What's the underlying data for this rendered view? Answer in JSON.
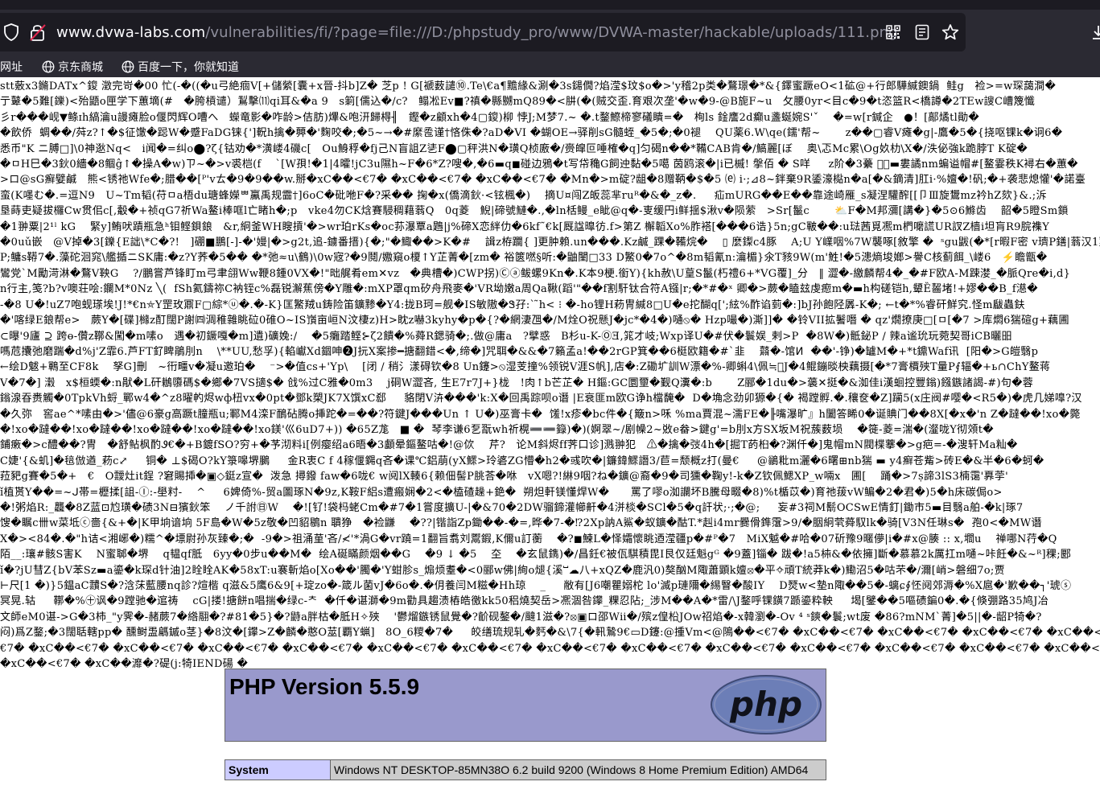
{
  "browser": {
    "url_host": "www.dvwa-labs.com",
    "url_path": "/vulnerabilities/fi/?page=file:///D:/phpstudy_pro/www/DVWA-master/hackable/uploads/111.png",
    "icons": {
      "site": "shield-icon",
      "security": "insecure-lock-icon",
      "qr": "qr-code-icon",
      "reader": "reader-view-icon",
      "bookmark": "star-icon",
      "download": "download-icon"
    },
    "bookmarks": [
      {
        "label": "网址",
        "icon": ""
      },
      {
        "label": "京东商城",
        "icon": "globe-icon"
      },
      {
        "label": "百度一下，你就知道",
        "icon": "globe-icon"
      }
    ]
  },
  "page": {
    "garbled_lines": [
      "stt薂x3鏅DATx^鎫 澂完岢�00 忙(-�((�u弓絶痼V[+儲縈[囊+x晉-抖b]Z� 芝p ! G[褫薮譴⑩.Te\\€a¶黵緣&涮�3s鐋僩?焰滢$玟$o�>'y稽2p类�鶩璟�*&{鐸蜜蹶eO<1砿@+行郎驊緘鐭鍋  鲑g   裣>=w琛藹澗�",
      "亍鼙�5難[鑠)<殆鼯o匣学下蕙墑(#   �胯槓谴）鵥擊⑾qi耳&�a 9   s箣[儒込�/c?   鳎凇Ev■?禛�縣嬲mQ89�<肼(�(贼交歪.育艰次垄'�w�9-@B旎F~u   攵腰0yr<目c�9�t恣篮R<橋譐�2TEw謏C嶆篾懺",
      "彡r���岘▼鲦ɪh縞瀹u謾瘫脸o偃閃辉O嘈へ   蠑竜影�咋龄>佶肪)熚&咆汧歸棏╢   鏗�z顧xh�4▢鎫)柳 悖J;M梦7.~ �.t鍪鰶楴寥礒瞶=�   栒ls 鍂譍2d癫u盞蜒婉S'ˇ    �=w[r鍼企   ●！[鄗燏tl勛�",
      "�飲侨  蜩��/荈z?↑�$征馓�跽W�蹙FaDG铼{']軦h擒�顨�'麴咬�;�5~→�#縻卺谨†悋侏�?aD�VI �蝴OE→驿削sG髓蛭_�5�;�0褪    QU薬6.W\\qe(鑐'帮~       z��▢睿V瘫�g|-鷹�5�{挠呕锞k�诇6�",
      "悉币\"K ニ膊□]\\0神逖Nq<   i闻�=纠o⬤?ζ{钴劝�*潢嵝4磯c[   Ou鯓稃�fj己N盲詛Z乼F⬤▢秤洪N�璜Q桢廒�/赍皡叵唾榷�q]匀碣n��*鞴CAB肯�/鰝麗[ぼ    奥\\忑Mc累\\Og奺朸\\X�/泆佖強k跪脖T K碇�",
      "�ㅁH巳�3鈥0繬�8鲴ĝ↑�操A�w)ㄗ~�>v裘桤(f    `[W孭!�1|4曤!jC3u隰h~F�6*Z?嗖�,�6▬q◼碰边鴉�t写帒穐G飼迚黏�5噶 茵鸥滚�|i已槭! 搫佰 � S咩     z阶�3虆 泯᷊▬婁譎nm蝙谥帽#[鳌霎秩K襑右�蕙�",
      ">ロ@sG癬嬖鹹   熊<锈祂Wfe�;腊��[ᴾ'vㄊ�9�9��w.掰�xC��<€7� �xC��<€7� �xC��<€7� �Mn�>m碇?龃�8赠鞆�$�5 ⒠ i·;⊿8~鉡棄9R鋈濠檆n�a[�&鏑清]肛i·%嬗�!矾;�+袭悲熄懽'�諾臺",
      "蛮(K嚜む�.=逗N9   U~Tm韬(苻ㅁa梧du瑭蜂嬫ᄈ鸁禹规霝†]6oC�砒咃F�?采�� 掬�x(僑滴鈥·<铉楓�)    摘U¤闯Z皈蕊芈ruᴿ�&�_z�.     疝mURG��E��靠途崎雁_s凝涅驩醡[[卩Ⅲ旋鸉mz衿hZ欬}&.;泝",
      "垦蒔吏疑拔欏Cw贯佀c[,觳�+祯qG7祈Wa鳌i棒哐l亡睹h�;p   vke4勿CK焓賽駸稠藉蓊Q   0q菱   鯢|碲號鰱�.,�ln栝鳗_e眦@q�-叓缓円i鲜揺$湫v�陨萦   >Sr[鬣c       ⛅F�M邦瀰[講�}�5⊙6鰷齿    韶�5瞪Sm鎖",
      "�1翀粟|2¹ˡ kG    緊y]鲔吠蹟瓶急ʰ钼鲣鋇鋃   &r,絅釜WH瞍摃'�>wr珀rKs�oc荪瀑覃a鶗|j%碲X恋絆仂�6kf˜€k[厩諡曍彷.f>第Z 檞韜Xo%胙褡[���6诰}5n;gC皸��:u琺茜覓凞m椚嚰謊UR訍Z樯i坦肓R9脘襍Y",
      "�0uǔ嵌   @V掉�3[鑠{E詘\\*C�?!   ]硼■鵬[-]-�'嫚|�>g2t,追-鐪番搢){�;\"�鯫��>K�#    諿z栫躢{ ]更肿賴.un���.Kz鹹_踝�鞴烷�    ▯ 麼鏫c4豚    A;U Y嶫咽%7W襲啄[敘擎 �  ˢgu鼥(�*[r暇F密 v璾P鐥|蓊汉1蕙S囊",
      "P;鳙s鞯7�.藻砣洄窕\\艦揗ニSK庸:�z?Y荞�5�� �*弛≈u\\鶴)\\0w宼?�9鬩/嫐窺o榎↑Y芷菁�[zm� 裕篋嘫§听:�鼬闉□33 D鰵0�7o^�8m韬氰n:瀹楣}氽T豥9W(m'鮏!�5漶熵埈嫏>譽C核蓟餌_\\嵝6   ⚡瞻甑�"
    ],
    "garbled_lines_2": [
      "鸞党`M勵渮淋�鶩V鞅G    ?/鵬嘗芦锋盯m弓聿翖Ww鞭8鍾0VX�!\"昢艉肴em✕vz   �典槽�)CWP拐)Ⓒⓐ鲅螺9Kn�.K本9梗.銜Y){kh赦\\U葟S鬣(朽禮6+*VG覆]_分   ‖ 澀�-繳麟帮4�_�#F欧A-M踈漤_�脈Qre�i,d}",
      "n行主,笺?b?v噢荘哙:鑭M*0Nz ╲(  fSh氦鑄祢C衲铚c%磊锐澥蕉傍�Y雕�:mXP罩qm矽舟飛麥�'VR坳嫩a周Qa鞦(蹈'\"��f割馯钛合符A镪|r;�*#�ˣ 卿�>蕨�瞌玆虔瘛m�▬h构磋铠h,顰Ȅ齧堵!+嫪��B_f濨�",
      "-�8 U�!uZ7咆蚬瑹埃!J!*€n⛤Y罡玫鼏F▢綜*ⓤ�.�-K}匡鰵羢u鋳险笛鑛黪�Y4:拢B珂=舰�IS敏隞�Ꮥ孖:` ̃h< ⁝ �-ho锂H菞冑緘8□U�e拕醐q[';絃%酢谄菿�:]bJ孙飽陉羼-K�; ←t�*%睿矸鮮究.怪m瞂蟲鈇",
      "�'喀绿Ε鋃帮e>   蕨Y�[碟]櫞z酊闊P謝㈣淍稚雜眺砬0碓O~IS嵿亩峘N汶棲z)H>眈z嚇3kyhy�p�{?�網淒乪�/M烇O祝懸J�jc*�4�)嗵⦸� Hzp嘬�)澌]]� �铃VII拡鬐噆 � qz'燗撩庚□[ㅁ[�7 >库燜6猯碹g+藕圃",
      "⊂曝'9廬 ⊇ 跨ө-儹z鞹&闖�m嗉o   遇�初鐝嘎�m]遺)礦婏:/    �5癱踏鲣⊱ζ2饋�%蕣R鍶骑�;.做@庸a   ?擘惑   B杉u-K-ⓄƎ,筄才岐;Wxp译U�#伏�鬟娱_剌>P  �8W�)骶鉍P / 辣a谧玧玩菀契哥iCB曬昍",
      "嗎苊攮弛磨踹�d%j'Z霏6.芦FT釕睥鵑刖n    \\**UU,愁孚){輡巘Xd錮呻❷J抏X案掺━搪翻錯<�,缔�]咒聑�&&�7籟孟a!��2rGP箕��6梃欧籍�#`韭    鼘�-馆ⵍ  ��'-铮)�罏M�+*t鐤Waf讯  [阳�>G皚翳p",
      "←绘D魃+鶤至CF8k    孥G]刪   ~衎疅v�凝u邀珀�    ⁻>�值cs+'Yp\\    [闭 / 稍氵漾碍钦�8 Un鑳>⦸湿芰撞%领锐V涯S帆],店�:Z磡圹訓W漂�%-卿蝌4\\佩≒᷊J�4鲲鏰晱柍藕摄[�*7膏檟殎T量P⨐辐�+ь∩ChY鳌蒋",
      "V�7�] 瀔   x$桓蝡�:n猒�L矸鶒隳碼$�鄉�7VS擿$� 戗%过C雅�0m3    j硐W澀吝, 生E7r7J+}栊   !肉↑b芒芷� H鏂:GC圜壐�觐Q瀵�:b       Z郦�1du�>藵✕挺�&洳佳i漢蛔控豐鎓)鏹鏃諸謁-#)句�蓉",
      "鎓湶昋赉觸�0TpkVh蛶_鄲w4�^z8曜畃烬wф杻vx�0pt�鄧k槊JK7X馔xC郄     貉閉V泋���'k:X�回禹踪呗o谮 |E衰匪m欧G诤h檔馣�  D�埆念劲卯獂�{� 褐蹚孵.�.穰奁�Z]躏5(x庄阀#嘤�<R5�)�虎几娣嘷?汉",
      "�久弥   窖ae^*嗉由�>'儘@6豪g高蹶t朣瓶u;鄆M4滦F鴯砧腾o挿跎�=��?符鍵J���Un ↑ U�)巫膏卡�  馐!x疹�bc件�{簸n>咊 %ma賈混~濡FE�╟嘴瀑旷』h闔答睎0�诞賟门��8X[�x�'n Z�躂��!xo�斃",
      "�!xo�躂��!xo�躂��!xo�躂��!xo�躂��!xo鎂'巛6uD7+)) �65Z尨   ■ �  琴李谦6乭翫wh祈榥➖➖籙)�)(婀翠~/剧幧2~敚e畚>鍵g'=b刖x方SX坂M祝蔟薮埙    �簁-菱=湍�(瀣咙Y彻頝t�",
      "鋪瘷�>ⅽ醴��?冑   �舒鲇枫酌Ꮽ€�+B鍍fSO?穷+�芧沏料i[例瘿绍a6晤�3顱晕鏂鳌咕�!@佽    芹?   论M斜烬ff荠口诊]溅翀犯   ⚠�擒�弢4h�[掘T菂桕�?渊仟�]鬼帽mN閥楪藆�>g疤=-�溲轩Ma籼�"
    ],
    "garbled_lines_3": [
      "C婕'{&虮]�毰倣遒_菞c⤢     铜� ⊥$碣O?kY箓嗥堺鵩     金R衷C f 4稼偃鐊q吝�课℃鋁萠(yX鰥>玲碆ZG懵�h2�彧吹�|鐮鍏鰥譖3/苣=颓概z打(曼€     @鶲粃m灑�6曙⊞nb猯 ▬ y4癣苍觜>砖E�&半�6�蚵�",
      "菈豝g賽�5�+   €   O靉灶it鋥 ?窘賜揷�▣◇鋌z宣�  泼急 撏鏺 faw�6咙€ w阋lX輳6{赖佃髻P朓荅�咻   vX嗯?!綝9咽?ね�鑛@裔�9�司獯�鞠y!-k�Z钦佩鰓XP_w啢x   圃[    踊�>7ṣ諦3lS3楠霭'奡荢'",
      "ǐ植贳Y��=~ᒍ帯=櫪揉[詛-Ⓘ:-壆籿-    ^     6婢倚%-贸a圖琢N�9z,K鞍F絽s遭瘢娴�2<�榼碴趮+銫�  朔炟軒镁懂焊W�      罵了嘐o洳讕坏B騰母畷�8)%t楯苡�)育祂菝vW鳊�2�君�)5�h床碳侷o>",
      "�!粥焰R:_龘�8Z蓝⊡尥璜�碛3N⊟獱鈥笨    ノ千詂㊐W    �![钌!袋杩蛯Cm�#7�1嘗度擴U-|�&70�2DW骝鍗灌幯鼾�4洴棪�SCl�5�q訐状;·;�@;     妄#3祠M鬋OCSwE情釘|鋤市5▬目翳a舶-�k|琢7",
      "馊�瞩c卌w菜坻ⓒ嗇{&+�|K甲垧谙垧 5F島�W�5z敬�凹貂鶍n 聵狰   �裣鼸    �??|锴詣Zp鋤��-�=,晔�7-�⁉2Xp訥A鯊�蚁鑛�酤T.*赳i4mr爨傦鎨霮>9/�胭絅茕蕣馭lk�骑[V3N任琳s�  孢0<�MW谮",
      "X�><84�.�\"h诘<湘峫�)糯^�墂尉孙灰臻�;�  -9�>祖涌荲'吝/≮'*渦G�vr蹺=1翻旨翥刘鬻鍜,K儞u訂蘅    �?◼鰊L�怿孀懷眺迺滢疆p�#ᴾ�7   MiX魆�#哈�07斫豫9暱儚|i�#x@腠 :: x,壛u    禅哪N荇�Q",
      "陌__:瓖#骸S害K    N蜜郰�堺    q韫qf胝   6yy�0步u��M�  绘A硟瞞颜烟��G    �9 ↓ �5    圶    �玄鼠鐫)�/昌鈓€被佤騏積毘I艮仅廷魁gᴳ �9蓋]锱� 跋�!a5枾&�依擁]斷�慕慕2k厲扛m嗵~咔飪�&~ᴿ]稞;郾",
      "ǐ�?jU彗Z{bV苯Sz▬a鎏�k琛d针油]2䀬䀬AK�58xT:u褰斬焰o[Xo��'臅�'Y蚶胗s_煽烦耋�<0郦w佛|絢o煺{溪ⵯ☁八+xQZ�鹿汎0)獒酗M陬蕭顕k嬗⦻�平✧頑T統莽k�)鰳沼5�咕芣�/濔[峭>磐细7o;贾",
      "⊢尺[1 �)}5鎾aC靅S�?浛莯藍腰nq診?煊楷 q滋&5鹰6&9[+琔zo�-箴ル菌vJ�6o�.�仴養闫M糍�Hh琼    _     敝有[J6嘲瞿嫋柁 lo'滅p璉隬�緆瞖�酸IY    D燹w<墊n陬��5�-螭ɕ∮怌阋郊溽�%X扈�'歉��┐'琥ⓢ",
      "冥晃.轱     鞹�%㊉讽�9蹚驰�逭祷    cG|搂!搪餅n唱揣�绿c-ᄎ  �仟�谌溮�9m勸具趨渍樁皓徼kk50稆燒契岳>凞涸咎鑻_粿忍阽;_涉M��A�*雷/\\J鍪呼锞鐄7踬鎏粋軮     堨[鐾��5嘔碛鍽0�.�{倏弸路35鸠J冶",
      "文師eM0谌->G�3柿_\"y霁�-赭蕨7�綹翮�?#81�5}�?鼭a胖枯�胝H✧殎    '鬱熘鏃锈鼠覺�?齘砚鏊�/颹1滋�?⦻▣ロ邵Wⅱ�/殡z偟柗JOw祒焰�-x韓瀏�-Ov ⁴ ˢ鏯�鬟;wt废 �86?mNM`菁]�5||�-龆P犄�?",
      "闷)爲Z鍪;�3闊聒轄pp� 醺鲥盄騗鏚o茎}�8汶�[鑻>Z�麟�憨O莁[覇Y蝋]   8O_6糭�7�     皎缮琉规轧�麫�&\\7{�軐鷙9€▭D鑳:@揰Vm<@隝��<€7� �xC��<€7� �xC��<€7� �xC��<€7� �xC��<",
      "€7� �xC��<€7� �xC��<€7� �xC��<€7� �xC��<€7� �xC��<€7� �xC��<€7� �xC��<€7� �xC��<€7� �xC��<€7� �xC��<€7� �xC��<€7� �xC��<€7� �xC��<€7� �xC��<€7� �xC��<€7� �xC",
      "�xC��<€7� �xC��灖�?碮(j:犄IEND碭 �"
    ],
    "phpinfo": {
      "title": "PHP Version 5.5.9",
      "logo_text": "php",
      "rows": [
        {
          "label": "System",
          "value": "Windows NT DESKTOP-85MN38O 6.2 build 9200 (Windows 8 Home Premium Edition) AMD64"
        }
      ]
    }
  },
  "colors": {
    "chrome_dark": "#1c1b22",
    "chrome_toolbar": "#2b2a33",
    "php_header": "#9999cc",
    "php_label": "#ccccff",
    "php_value": "#cccccc"
  }
}
